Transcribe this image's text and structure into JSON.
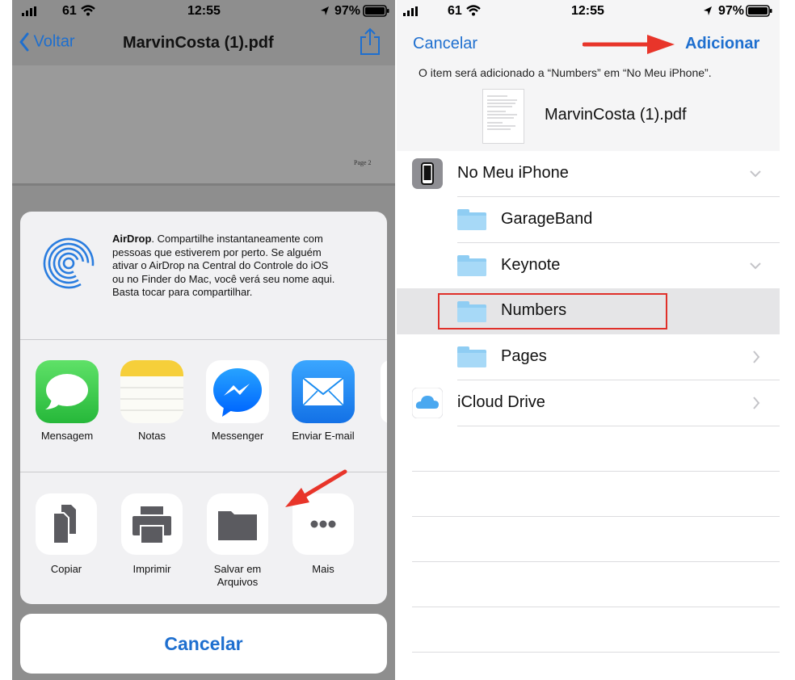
{
  "left": {
    "status": {
      "signal_text": "61",
      "time": "12:55",
      "battery": "97%"
    },
    "nav": {
      "back": "Voltar",
      "title": "MarvinCosta (1).pdf",
      "share_icon": "share-icon"
    },
    "pdf_page_label": "Page 2",
    "airdrop": {
      "title": "AirDrop",
      "lines": [
        ". Compartilhe instantaneamente com",
        "pessoas que estiverem por perto. Se alguém",
        "ativar o AirDrop na Central do Controle do iOS",
        "ou no Finder do Mac, você verá seu nome aqui.",
        "Basta tocar para compartilhar."
      ]
    },
    "apps": [
      {
        "label": "Mensagem",
        "icon": "messages-icon",
        "color": "#3ccb4a"
      },
      {
        "label": "Notas",
        "icon": "notes-icon",
        "color": "#f6cf3a"
      },
      {
        "label": "Messenger",
        "icon": "messenger-icon",
        "color": "#0b84ff"
      },
      {
        "label": "Enviar E-mail",
        "icon": "mail-icon",
        "color": "#1a8cf0"
      }
    ],
    "actions": [
      {
        "label": "Copiar",
        "icon": "copy-icon"
      },
      {
        "label": "Imprimir",
        "icon": "print-icon"
      },
      {
        "label_line1": "Salvar em",
        "label_line2": "Arquivos",
        "icon": "folder-icon"
      },
      {
        "label": "Mais",
        "icon": "more-icon"
      }
    ],
    "cancel": "Cancelar"
  },
  "right": {
    "status": {
      "signal_text": "61",
      "time": "12:55",
      "battery": "97%"
    },
    "cancel": "Cancelar",
    "add": "Adicionar",
    "info": "O item será adicionado a “Numbers” em “No Meu iPhone”.",
    "file_name": "MarvinCosta (1).pdf",
    "locations": [
      {
        "label": "No Meu iPhone",
        "icon": "iphone-icon",
        "chevron": "down"
      },
      {
        "label": "GarageBand",
        "icon": "folder-icon",
        "chevron": "none"
      },
      {
        "label": "Keynote",
        "icon": "folder-icon",
        "chevron": "down"
      },
      {
        "label": "Numbers",
        "icon": "folder-icon",
        "chevron": "none",
        "selected": true
      },
      {
        "label": "Pages",
        "icon": "folder-icon",
        "chevron": "right"
      },
      {
        "label": "iCloud Drive",
        "icon": "icloud-icon",
        "chevron": "right"
      }
    ]
  },
  "colors": {
    "accent": "#1e6fcf",
    "arrow": "#e8352a",
    "highlight_box": "#e0302a",
    "folder": "#8fcdf3"
  }
}
